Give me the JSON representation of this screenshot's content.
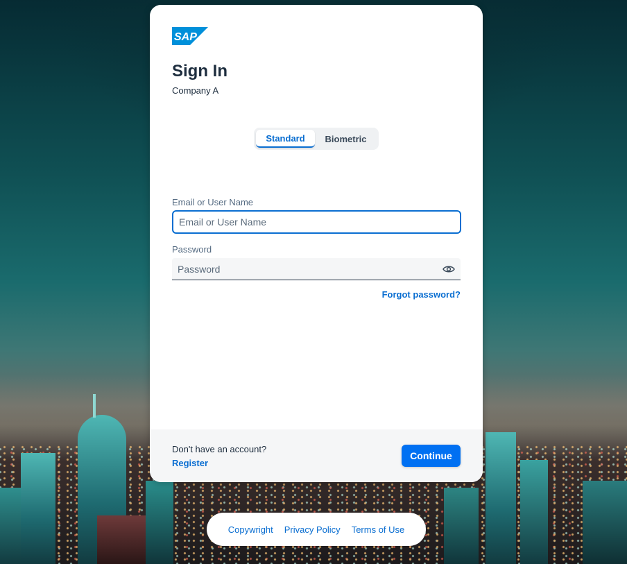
{
  "brand": {
    "logo_text": "SAP",
    "accent": "#0a6ed1",
    "logo_color": "#0090da"
  },
  "header": {
    "title": "Sign In",
    "subtitle": "Company A"
  },
  "mode_toggle": {
    "options": [
      "Standard",
      "Biometric"
    ],
    "selected": "Standard"
  },
  "form": {
    "email_label": "Email or User Name",
    "email_placeholder": "Email or User Name",
    "email_value": "",
    "password_label": "Password",
    "password_placeholder": "Password",
    "password_value": "",
    "show_password_icon": "eye-icon",
    "forgot_password": "Forgot password?"
  },
  "footer": {
    "no_account": "Don't have an account?",
    "register": "Register",
    "continue": "Continue"
  },
  "legal_links": [
    "Copywright",
    "Privacy Policy",
    "Terms of Use"
  ]
}
